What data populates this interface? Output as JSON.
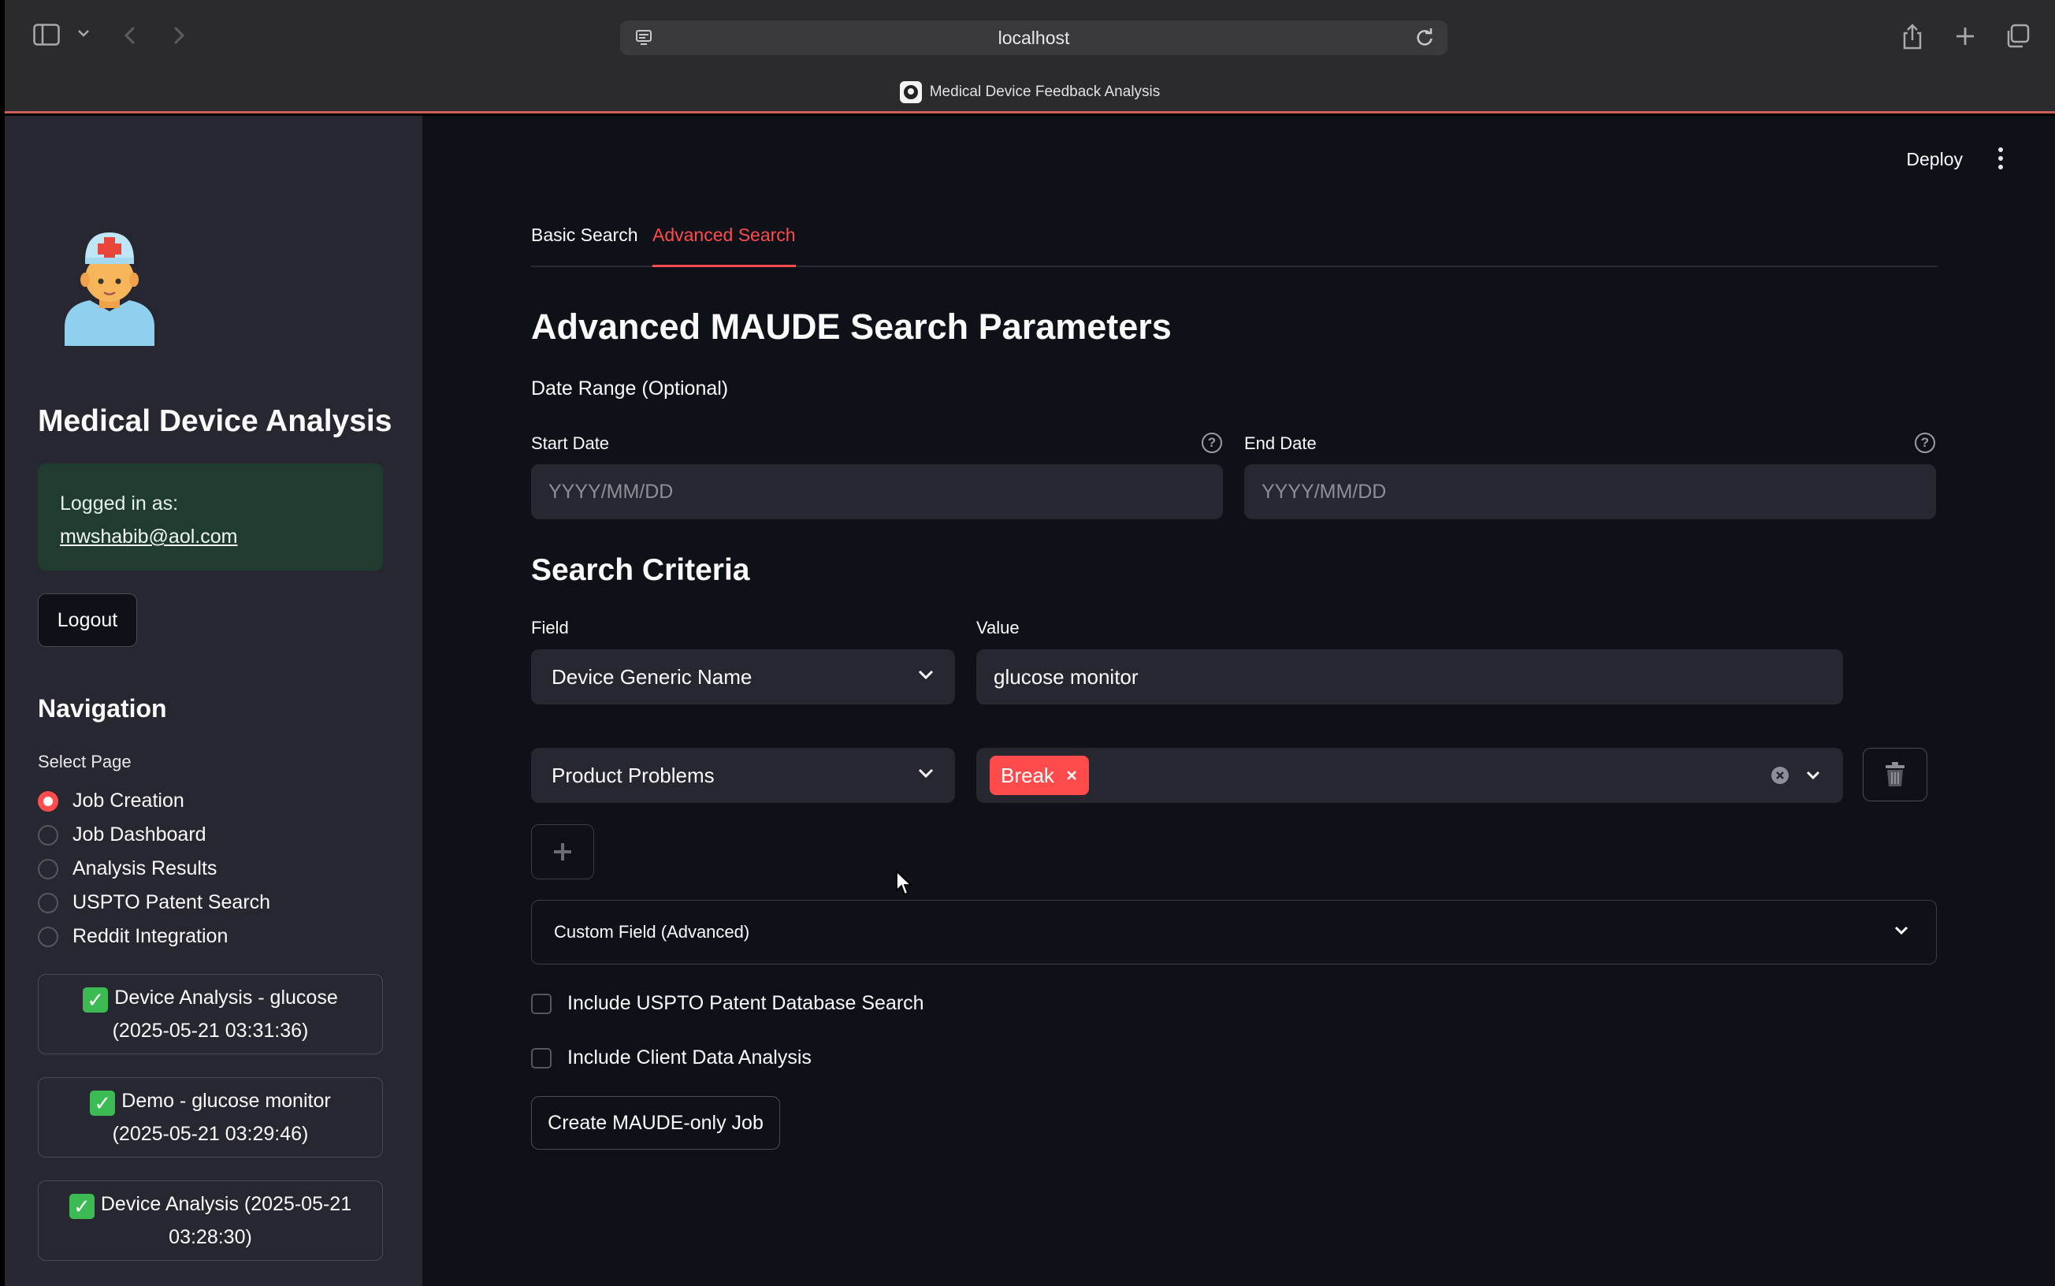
{
  "browser": {
    "url": "localhost",
    "tab_title": "Medical Device Feedback Analysis"
  },
  "sidebar": {
    "app_title": "Medical Device Analysis",
    "login_label": "Logged in as:",
    "login_email": "mwshabib@aol.com",
    "logout_label": "Logout",
    "nav_heading": "Navigation",
    "select_page_label": "Select Page",
    "pages": [
      {
        "label": "Job Creation",
        "selected": true
      },
      {
        "label": "Job Dashboard",
        "selected": false
      },
      {
        "label": "Analysis Results",
        "selected": false
      },
      {
        "label": "USPTO Patent Search",
        "selected": false
      },
      {
        "label": "Reddit Integration",
        "selected": false
      }
    ],
    "jobs": [
      {
        "line1": "Device Analysis - glucose",
        "line2": "(2025-05-21 03:31:36)"
      },
      {
        "line1": "Demo - glucose monitor",
        "line2": "(2025-05-21 03:29:46)"
      },
      {
        "line1": "Device Analysis (2025-05-21",
        "line2": "03:28:30)"
      }
    ]
  },
  "header": {
    "deploy_label": "Deploy"
  },
  "tabs": [
    {
      "label": "Basic Search",
      "active": false
    },
    {
      "label": "Advanced Search",
      "active": true
    }
  ],
  "main": {
    "title": "Advanced MAUDE Search Parameters",
    "date_range_label": "Date Range (Optional)",
    "start_date_label": "Start Date",
    "start_date_placeholder": "YYYY/MM/DD",
    "end_date_label": "End Date",
    "end_date_placeholder": "YYYY/MM/DD",
    "criteria_heading": "Search Criteria",
    "field_label": "Field",
    "value_label": "Value",
    "row1_field": "Device Generic Name",
    "row1_value": "glucose monitor",
    "row2_field": "Product Problems",
    "row2_tag": "Break",
    "custom_field_label": "Custom Field (Advanced)",
    "uspto_checkbox_label": "Include USPTO Patent Database Search",
    "client_checkbox_label": "Include Client Data Analysis",
    "create_job_label": "Create MAUDE-only Job"
  },
  "colors": {
    "accent": "#ff4b4b",
    "sidebar_bg": "#262730",
    "main_bg": "#0e1117",
    "login_box_bg": "#1f3c2f"
  }
}
